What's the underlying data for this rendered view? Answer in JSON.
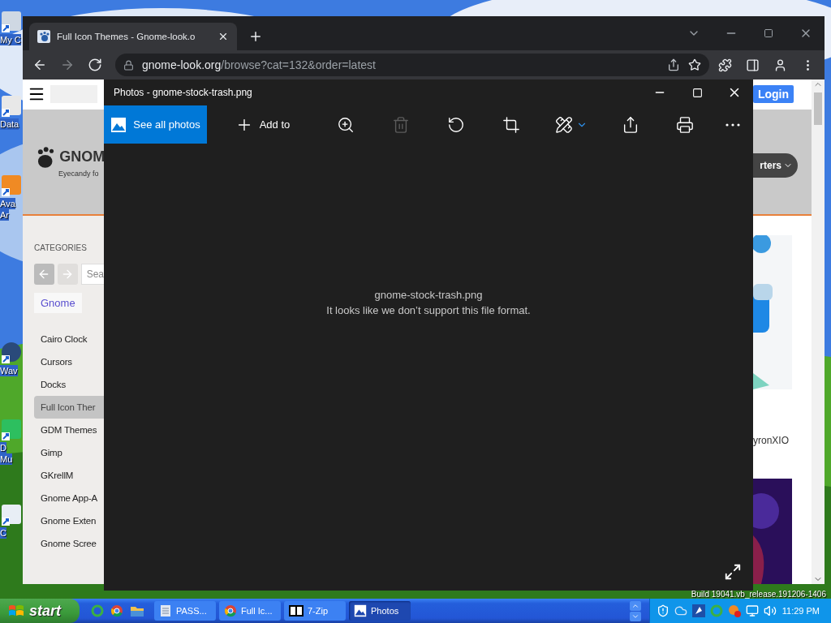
{
  "desktop": {
    "icons": [
      {
        "lines": [
          "My C"
        ],
        "kind": "computer"
      },
      {
        "lines": [
          "Data"
        ],
        "kind": "shortcut"
      },
      {
        "lines": [
          "Ava",
          "Ar"
        ],
        "kind": "app"
      },
      {
        "lines": [
          "Wav"
        ],
        "kind": "disc"
      },
      {
        "lines": [
          "D",
          "Mu"
        ],
        "kind": "green"
      },
      {
        "lines": [
          "C"
        ],
        "kind": "document"
      }
    ],
    "build_text": "Build 19041.vb_release.191206-1406"
  },
  "browser": {
    "tab": {
      "title": "Full Icon Themes - Gnome-look.o",
      "selected": true
    },
    "nav": [
      {
        "kind": "back",
        "disabled": false
      },
      {
        "kind": "forward",
        "disabled": true
      },
      {
        "kind": "reload",
        "disabled": false
      }
    ],
    "url": {
      "host": "gnome-look.org",
      "path": "/browse?cat=132&order=latest"
    }
  },
  "page": {
    "login": "Login",
    "logo_text": "GNOM",
    "logo_tagline": "Eyecandy fo",
    "menu_button": "rters",
    "categories_heading": "CATEGORIES",
    "search_placeholder": "Sea",
    "breadcrumb": "Gnome",
    "categories": [
      {
        "label": "Cairo Clock",
        "selected": false
      },
      {
        "label": "Cursors",
        "selected": false
      },
      {
        "label": "Docks",
        "selected": false
      },
      {
        "label": "Full Icon Ther",
        "selected": true
      },
      {
        "label": "GDM Themes",
        "selected": false
      },
      {
        "label": "Gimp",
        "selected": false
      },
      {
        "label": "GKrellM",
        "selected": false
      },
      {
        "label": "Gnome App-A",
        "selected": false
      },
      {
        "label": "Gnome Exten",
        "selected": false
      },
      {
        "label": "Gnome Scree",
        "selected": false
      }
    ],
    "card_author": "yronXIO"
  },
  "photos": {
    "title": "Photos - gnome-stock-trash.png",
    "toolbar": [
      {
        "kind": "see-all",
        "label": "See all photos",
        "selected": true,
        "disabled": false
      },
      {
        "kind": "add",
        "label": "Add to",
        "selected": false,
        "disabled": false
      },
      {
        "kind": "zoom",
        "selected": false,
        "disabled": false
      },
      {
        "kind": "delete",
        "selected": false,
        "disabled": true
      },
      {
        "kind": "rotate",
        "selected": false,
        "disabled": false
      },
      {
        "kind": "crop",
        "selected": false,
        "disabled": false
      },
      {
        "kind": "edit",
        "selected": false,
        "disabled": false
      },
      {
        "kind": "share",
        "selected": false,
        "disabled": false
      },
      {
        "kind": "print",
        "selected": false,
        "disabled": false
      },
      {
        "kind": "more",
        "selected": false,
        "disabled": false
      }
    ],
    "file_name": "gnome-stock-trash.png",
    "message": "It looks like we don’t support this file format."
  },
  "taskbar": {
    "start": "start",
    "tasks": [
      {
        "kind": "notepad",
        "label": "PASS...",
        "selected": false
      },
      {
        "kind": "chrome",
        "label": "Full Ic...",
        "selected": false
      },
      {
        "kind": "zip",
        "label": "7-Zip",
        "selected": false
      },
      {
        "kind": "photos",
        "label": "Photos",
        "selected": true
      }
    ],
    "clock": "11:29 PM"
  }
}
